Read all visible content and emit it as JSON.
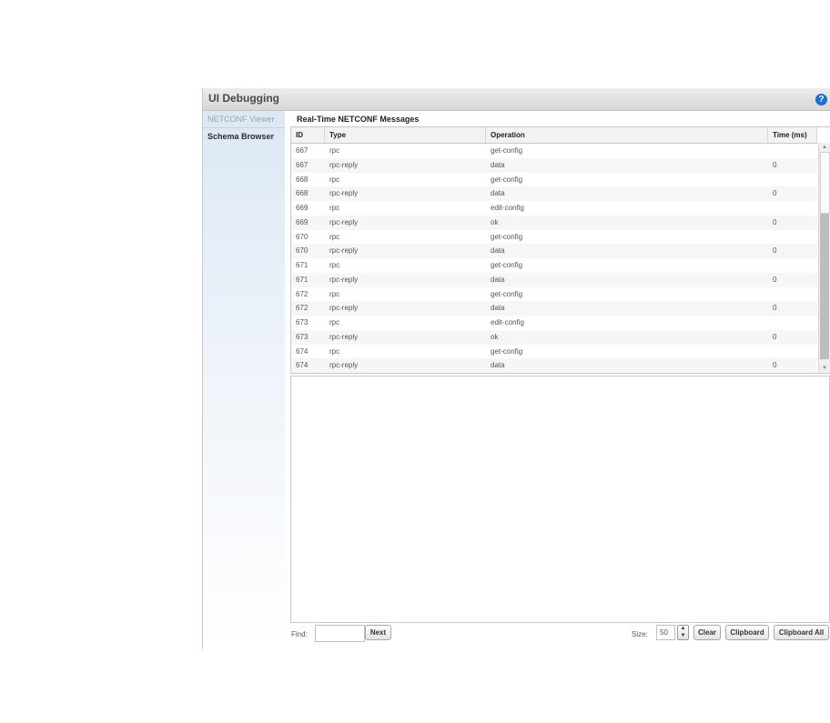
{
  "window": {
    "title": "UI Debugging",
    "help_glyph": "?"
  },
  "sidebar": {
    "items": [
      {
        "label": "NETCONF Viewer"
      },
      {
        "label": "Schema Browser"
      }
    ]
  },
  "panel": {
    "title": "Real-Time NETCONF Messages"
  },
  "table": {
    "columns": [
      "ID",
      "Type",
      "Operation",
      "Time (ms)"
    ],
    "rows": [
      {
        "id": "667",
        "type": "rpc",
        "op": "get-config",
        "time": ""
      },
      {
        "id": "667",
        "type": "rpc-reply",
        "op": "data",
        "time": "0"
      },
      {
        "id": "668",
        "type": "rpc",
        "op": "get-config",
        "time": ""
      },
      {
        "id": "668",
        "type": "rpc-reply",
        "op": "data",
        "time": "0"
      },
      {
        "id": "669",
        "type": "rpc",
        "op": "edit-config",
        "time": ""
      },
      {
        "id": "669",
        "type": "rpc-reply",
        "op": "ok",
        "time": "0"
      },
      {
        "id": "670",
        "type": "rpc",
        "op": "get-config",
        "time": ""
      },
      {
        "id": "670",
        "type": "rpc-reply",
        "op": "data",
        "time": "0"
      },
      {
        "id": "671",
        "type": "rpc",
        "op": "get-config",
        "time": ""
      },
      {
        "id": "671",
        "type": "rpc-reply",
        "op": "data",
        "time": "0"
      },
      {
        "id": "672",
        "type": "rpc",
        "op": "get-config",
        "time": ""
      },
      {
        "id": "672",
        "type": "rpc-reply",
        "op": "data",
        "time": "0"
      },
      {
        "id": "673",
        "type": "rpc",
        "op": "edit-config",
        "time": ""
      },
      {
        "id": "673",
        "type": "rpc-reply",
        "op": "ok",
        "time": "0"
      },
      {
        "id": "674",
        "type": "rpc",
        "op": "get-config",
        "time": ""
      },
      {
        "id": "674",
        "type": "rpc-reply",
        "op": "data",
        "time": "0"
      }
    ]
  },
  "toolbar": {
    "find_label": "Find:",
    "find_value": "",
    "next_label": "Next",
    "size_label": "Size:",
    "size_value": "50",
    "clear_label": "Clear",
    "clipboard_label": "Clipboard",
    "clipboard_all_label": "Clipboard All"
  }
}
